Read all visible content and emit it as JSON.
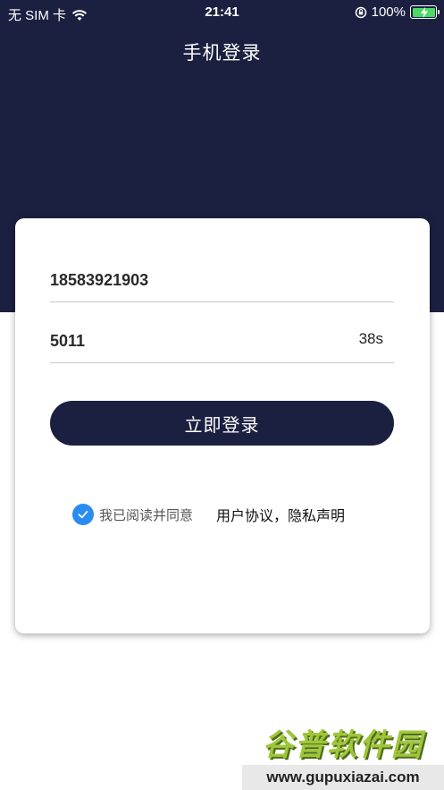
{
  "status_bar": {
    "carrier": "无 SIM 卡",
    "time": "21:41",
    "battery": "100%"
  },
  "header": {
    "title": "手机登录"
  },
  "form": {
    "phone_value": "18583921903",
    "code_value": "5011",
    "countdown": "38s",
    "login_label": "立即登录"
  },
  "agreement": {
    "checked": true,
    "text": "我已阅读并同意",
    "links": "用户协议，隐私声明"
  },
  "watermark": {
    "logo_text": "谷普软件园",
    "url": "www.gupuxiazai.com"
  },
  "colors": {
    "header_bg": "#1c2040",
    "button_bg": "#1c2040",
    "check_blue": "#2a8cf0",
    "battery_green": "#4cd964"
  }
}
